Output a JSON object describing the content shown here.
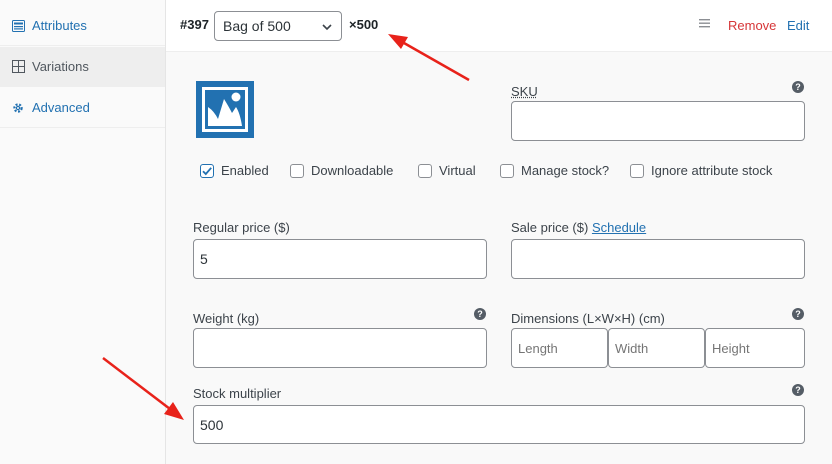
{
  "sidebar": {
    "items": [
      {
        "label": "Attributes",
        "icon": "list-icon"
      },
      {
        "label": "Variations",
        "icon": "grid-icon"
      },
      {
        "label": "Advanced",
        "icon": "gear-icon"
      }
    ]
  },
  "variation": {
    "id": "#397",
    "attribute_value": "Bag of 500",
    "multiplier_badge": "×500",
    "remove_label": "Remove",
    "edit_label": "Edit"
  },
  "fields": {
    "sku_label": "SKU",
    "sku_value": "",
    "checkboxes": [
      {
        "label": "Enabled",
        "checked": true
      },
      {
        "label": "Downloadable",
        "checked": false
      },
      {
        "label": "Virtual",
        "checked": false
      },
      {
        "label": "Manage stock?",
        "checked": false
      },
      {
        "label": "Ignore attribute stock",
        "checked": false
      }
    ],
    "regular_price_label": "Regular price ($)",
    "regular_price_value": "5",
    "sale_price_label": "Sale price ($)",
    "schedule_label": "Schedule",
    "sale_price_value": "",
    "weight_label": "Weight (kg)",
    "weight_value": "",
    "dimensions_label": "Dimensions (L×W×H) (cm)",
    "length_placeholder": "Length",
    "width_placeholder": "Width",
    "height_placeholder": "Height",
    "stock_multiplier_label": "Stock multiplier",
    "stock_multiplier_value": "500",
    "help_glyph": "?"
  },
  "colors": {
    "link": "#2271b1",
    "remove": "#d63638",
    "annotation_arrow": "#e8221a",
    "image_icon": "#2271b1"
  }
}
